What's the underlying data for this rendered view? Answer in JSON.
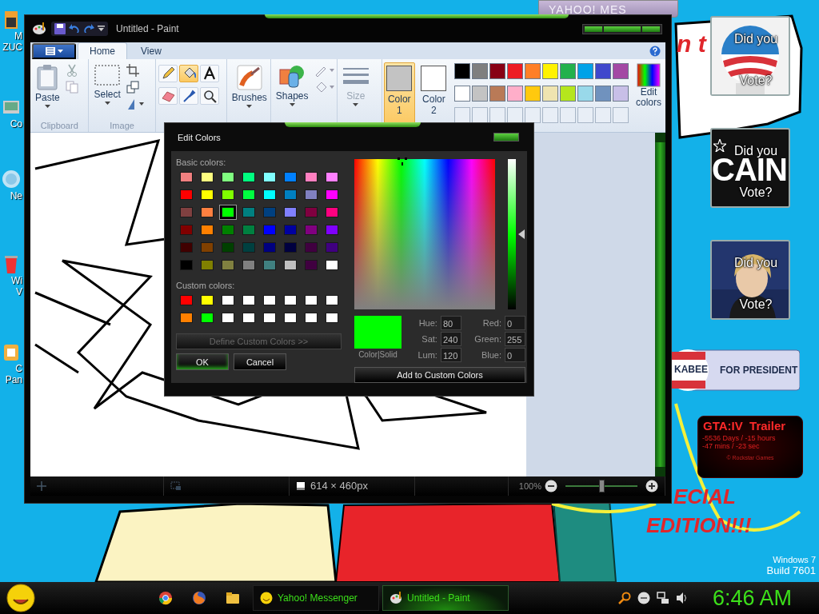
{
  "desktop_icons": [
    {
      "lines": [
        "M",
        "ZUC"
      ]
    },
    {
      "lines": [
        "Co"
      ]
    },
    {
      "lines": [
        "Ne"
      ]
    },
    {
      "lines": [
        "Wi",
        "V"
      ]
    },
    {
      "lines": [
        "C",
        "Pan"
      ]
    }
  ],
  "wallpaper_texts": [
    "n t",
    "ECIAL",
    "EDITION!!!"
  ],
  "background_window": {
    "title": "YAHOO! MES"
  },
  "paint": {
    "title": "Untitled - Paint",
    "tabs": [
      {
        "label": "Home",
        "selected": true
      },
      {
        "label": "View",
        "selected": false
      }
    ],
    "ribbon": {
      "paste": "Paste",
      "clipboard_label": "Clipboard",
      "select": "Select",
      "image_label": "Image",
      "tools": [
        {
          "selected": false
        },
        {
          "selected": true
        },
        {
          "selected": false
        },
        {
          "selected": false
        },
        {
          "selected": false
        },
        {
          "selected": false
        }
      ],
      "brushes": "Brushes",
      "shapes": "Shapes",
      "size": {
        "label": "Size",
        "disabled": true
      },
      "colors": [
        {
          "label": "Color",
          "number": "1",
          "color": "#c3c3c3",
          "selected": true
        },
        {
          "label": "Color",
          "number": "2",
          "color": "#ffffff",
          "selected": false
        }
      ],
      "palette": [
        {
          "color": "#000000"
        },
        {
          "color": "#7f7f7f"
        },
        {
          "color": "#880015"
        },
        {
          "color": "#ed1c24"
        },
        {
          "color": "#ff7f27"
        },
        {
          "color": "#fff200"
        },
        {
          "color": "#22b14c"
        },
        {
          "color": "#00a2e8"
        },
        {
          "color": "#3f48cc"
        },
        {
          "color": "#a349a4"
        },
        {
          "color": "#ffffff"
        },
        {
          "color": "#c3c3c3"
        },
        {
          "color": "#b97a57"
        },
        {
          "color": "#ffaec9"
        },
        {
          "color": "#ffc90e"
        },
        {
          "color": "#efe4b0"
        },
        {
          "color": "#b5e61d"
        },
        {
          "color": "#99d9ea"
        },
        {
          "color": "#7092be"
        },
        {
          "color": "#c8bfe7"
        },
        {
          "kind": "empty"
        },
        {
          "kind": "empty"
        },
        {
          "kind": "empty"
        },
        {
          "kind": "empty"
        },
        {
          "kind": "empty"
        },
        {
          "kind": "empty"
        },
        {
          "kind": "empty"
        },
        {
          "kind": "empty"
        },
        {
          "kind": "empty"
        },
        {
          "kind": "empty"
        }
      ],
      "edit_colors": "Edit colors"
    },
    "status": {
      "dimensions": "614 × 460px",
      "zoom": "100%",
      "zoom_slider": {
        "level": 0.5
      }
    }
  },
  "dialog": {
    "title": "Edit Colors",
    "basic_label": "Basic colors:",
    "basic_colors": [
      {
        "color": "#f08080",
        "selected": false
      },
      {
        "color": "#ffff80",
        "selected": false
      },
      {
        "color": "#80ff80",
        "selected": false
      },
      {
        "color": "#00ff80",
        "selected": false
      },
      {
        "color": "#80ffff",
        "selected": false
      },
      {
        "color": "#0080ff",
        "selected": false
      },
      {
        "color": "#ff80c0",
        "selected": false
      },
      {
        "color": "#ff80ff",
        "selected": false
      },
      {
        "color": "#ff0000",
        "selected": false
      },
      {
        "color": "#ffff00",
        "selected": false
      },
      {
        "color": "#80ff00",
        "selected": false
      },
      {
        "color": "#00ff40",
        "selected": false
      },
      {
        "color": "#00ffff",
        "selected": false
      },
      {
        "color": "#0080c0",
        "selected": false
      },
      {
        "color": "#8080c0",
        "selected": false
      },
      {
        "color": "#ff00ff",
        "selected": false
      },
      {
        "color": "#804040",
        "selected": false
      },
      {
        "color": "#ff8040",
        "selected": false
      },
      {
        "color": "#00ff00",
        "selected": true
      },
      {
        "color": "#008080",
        "selected": false
      },
      {
        "color": "#004080",
        "selected": false
      },
      {
        "color": "#8080ff",
        "selected": false
      },
      {
        "color": "#800040",
        "selected": false
      },
      {
        "color": "#ff0080",
        "selected": false
      },
      {
        "color": "#800000",
        "selected": false
      },
      {
        "color": "#ff8000",
        "selected": false
      },
      {
        "color": "#008000",
        "selected": false
      },
      {
        "color": "#008040",
        "selected": false
      },
      {
        "color": "#0000ff",
        "selected": false
      },
      {
        "color": "#0000a0",
        "selected": false
      },
      {
        "color": "#800080",
        "selected": false
      },
      {
        "color": "#8000ff",
        "selected": false
      },
      {
        "color": "#400000",
        "selected": false
      },
      {
        "color": "#804000",
        "selected": false
      },
      {
        "color": "#004000",
        "selected": false
      },
      {
        "color": "#004040",
        "selected": false
      },
      {
        "color": "#000080",
        "selected": false
      },
      {
        "color": "#000040",
        "selected": false
      },
      {
        "color": "#400040",
        "selected": false
      },
      {
        "color": "#400080",
        "selected": false
      },
      {
        "color": "#000000",
        "selected": false
      },
      {
        "color": "#808000",
        "selected": false
      },
      {
        "color": "#808040",
        "selected": false
      },
      {
        "color": "#808080",
        "selected": false
      },
      {
        "color": "#408080",
        "selected": false
      },
      {
        "color": "#c0c0c0",
        "selected": false
      },
      {
        "color": "#400040",
        "selected": false
      },
      {
        "color": "#ffffff",
        "selected": false
      }
    ],
    "custom_label": "Custom colors:",
    "custom_colors": [
      {
        "color": "#ff0000"
      },
      {
        "color": "#ffff00"
      },
      {
        "color": "#ffffff"
      },
      {
        "color": "#ffffff"
      },
      {
        "color": "#ffffff"
      },
      {
        "color": "#ffffff"
      },
      {
        "color": "#ffffff"
      },
      {
        "color": "#ffffff"
      },
      {
        "color": "#ff8000"
      },
      {
        "color": "#00ff00"
      },
      {
        "color": "#ffffff"
      },
      {
        "color": "#ffffff"
      },
      {
        "color": "#ffffff"
      },
      {
        "color": "#ffffff"
      },
      {
        "color": "#ffffff"
      },
      {
        "color": "#ffffff"
      }
    ],
    "define_button": {
      "label": "Define Custom Colors >>",
      "disabled": true
    },
    "ok": "OK",
    "cancel": "Cancel",
    "preview": {
      "color": "#00ff00",
      "label": "Color|Solid"
    },
    "fields": [
      {
        "label": "Hue:",
        "value": "80"
      },
      {
        "label": "Red:",
        "value": "0"
      },
      {
        "label": "Sat:",
        "value": "240"
      },
      {
        "label": "Green:",
        "value": "255"
      },
      {
        "label": "Lum:",
        "value": "120"
      },
      {
        "label": "Blue:",
        "value": "0"
      }
    ],
    "add_button": "Add to Custom Colors"
  },
  "gadgets": [
    {
      "kind": "emblem",
      "top": "Did you",
      "bottom": "Vote?"
    },
    {
      "kind": "logo",
      "logo_text": "CAIN",
      "top": "Did you",
      "bottom": "Vote?"
    },
    {
      "top": "Did you",
      "bottom": "Vote?"
    },
    {
      "kind": "banner",
      "name_text": "KABEE",
      "slogan": "FOR PRESIDENT"
    },
    {
      "kind": "countdown",
      "title": "GTA:IV  Trailer",
      "lines": [
        "-5536 Days / -15 hours",
        "-47 mins / -23 sec"
      ],
      "credit": "© Rockstar Games"
    }
  ],
  "os_build": [
    "Windows 7",
    "Build 7601"
  ],
  "taskbar": {
    "tasks": [
      {
        "label": "Yahoo! Messenger",
        "active": false
      },
      {
        "label": "Untitled - Paint",
        "active": true
      }
    ],
    "clock": "6:46 AM"
  }
}
